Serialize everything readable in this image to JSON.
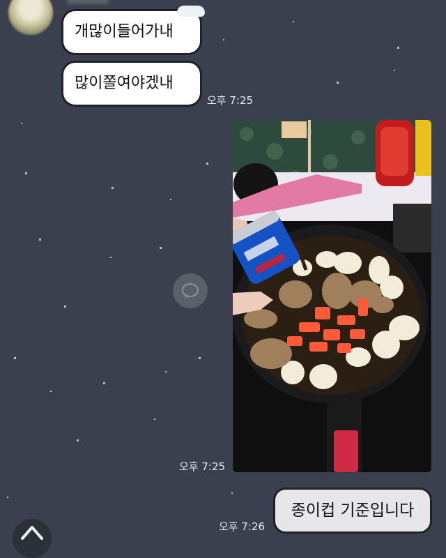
{
  "messages": [
    {
      "kind": "incoming-text",
      "text": "개많이들어가내"
    },
    {
      "kind": "incoming-text",
      "text": "많이쫄여야겠내",
      "time": "오후 7:25"
    },
    {
      "kind": "incoming-photo",
      "time": "오후 7:25"
    },
    {
      "kind": "outgoing-text",
      "text": "종이컵 기준입니다",
      "time": "오후 7:26"
    }
  ],
  "icons": {
    "share": "speech-bubble-icon",
    "scroll": "chevron-up-icon",
    "avatar": "avatar"
  },
  "colors": {
    "background": "#3a404d",
    "incoming_bubble": "#ffffff",
    "outgoing_bubble": "#e7e7ea",
    "timestamp": "#e6e8ec"
  }
}
